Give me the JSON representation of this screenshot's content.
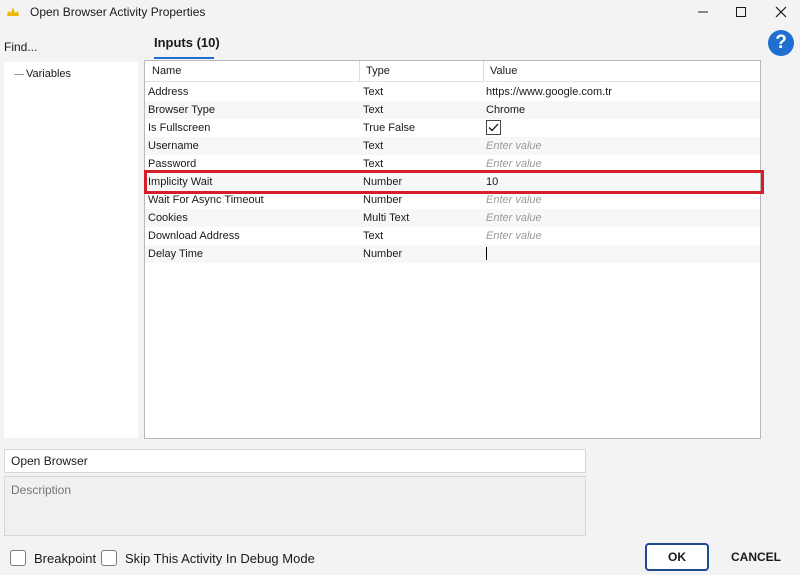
{
  "window": {
    "title": "Open Browser Activity Properties"
  },
  "sidebar": {
    "find_label": "Find...",
    "tree_items": [
      "Variables"
    ]
  },
  "tab": {
    "label": "Inputs (10)"
  },
  "grid": {
    "columns": [
      "Name",
      "Type",
      "Value"
    ],
    "rows": [
      {
        "name": "Address",
        "type": "Text",
        "value": "https://www.google.com.tr"
      },
      {
        "name": "Browser Type",
        "type": "Text",
        "value": "Chrome"
      },
      {
        "name": "Is Fullscreen",
        "type": "True False",
        "value": "",
        "checked": true
      },
      {
        "name": "Username",
        "type": "Text",
        "value": "",
        "placeholder": "Enter value"
      },
      {
        "name": "Password",
        "type": "Text",
        "value": "",
        "placeholder": "Enter value"
      },
      {
        "name": "Implicity Wait",
        "type": "Number",
        "value": "10"
      },
      {
        "name": "Wait For Async Timeout",
        "type": "Number",
        "value": "",
        "placeholder": "Enter value"
      },
      {
        "name": "Cookies",
        "type": "Multi Text",
        "value": "",
        "placeholder": "Enter value"
      },
      {
        "name": "Download Address",
        "type": "Text",
        "value": "",
        "placeholder": "Enter value"
      },
      {
        "name": "Delay Time",
        "type": "Number",
        "value": ""
      }
    ]
  },
  "activity": {
    "name_value": "Open Browser",
    "description_placeholder": "Description"
  },
  "footer": {
    "breakpoint_label": "Breakpoint",
    "skip_label": "Skip This Activity In Debug Mode",
    "ok_label": "OK",
    "cancel_label": "CANCEL"
  },
  "colors": {
    "accent": "#1e6fd0",
    "highlight": "#d81d2a",
    "ok_border": "#1e4a92"
  }
}
